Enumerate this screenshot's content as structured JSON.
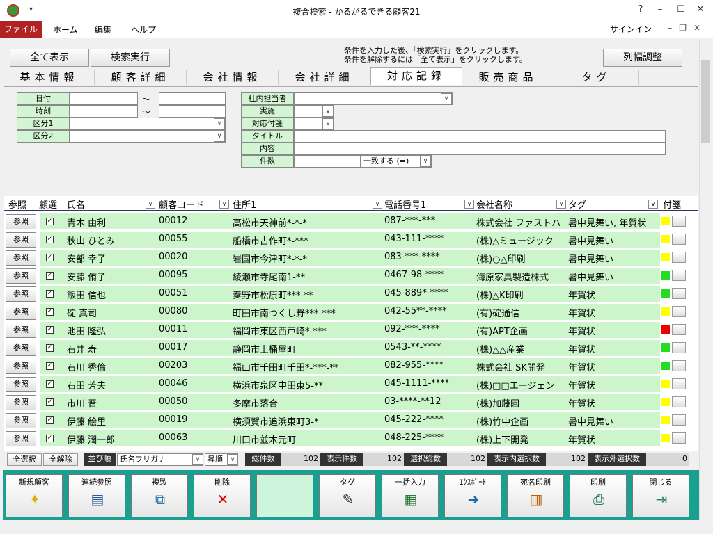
{
  "window": {
    "title": "複合検索 - かるがるできる顧客21",
    "help": "?",
    "minimize": "–",
    "maximize": "☐",
    "close": "✕"
  },
  "ribbon": {
    "tabs": [
      "ファイル",
      "ホーム",
      "編集",
      "ヘルプ"
    ],
    "signin": "サインイン"
  },
  "top": {
    "show_all": "全て表示",
    "search": "検索実行",
    "col_adjust": "列幅調整",
    "hint1": "条件を入力した後、「検索実行」をクリックします。",
    "hint2": "条件を解除するには「全て表示」をクリックします。"
  },
  "tabs": [
    "基本情報",
    "顧客詳細",
    "会社情報",
    "会社詳細",
    "対応記録",
    "販売商品",
    "タグ"
  ],
  "cond": {
    "date": "日付",
    "time": "時刻",
    "kubun1": "区分1",
    "kubun2": "区分2",
    "tilde": "～",
    "staff": "社内担当者",
    "done": "実施",
    "attach": "対応付箋",
    "title": "タイトル",
    "content": "内容",
    "count": "件数",
    "match": "一致する (=)"
  },
  "grid": {
    "headers": [
      "参照",
      "顧選",
      "氏名",
      "顧客コード",
      "住所1",
      "電話番号1",
      "会社名称",
      "タグ",
      "付箋"
    ],
    "ref_label": "参照",
    "check": "✓",
    "rows": [
      [
        "青木 由利",
        "00012",
        "高松市天神前*-*-*",
        "087-***-***",
        "株式会社 ファストハ",
        "暑中見舞い, 年賀状",
        "#ffff00"
      ],
      [
        "秋山 ひとみ",
        "00055",
        "船橋市古作町*-***",
        "043-111-****",
        "(株)△ミュージック",
        "暑中見舞い",
        "#ffff00"
      ],
      [
        "安部 幸子",
        "00020",
        "岩国市今津町*-*-*",
        "083-***-****",
        "(株)○△印刷",
        "暑中見舞い",
        "#ffff00"
      ],
      [
        "安藤 侑子",
        "00095",
        "綾瀬市寺尾南1-**",
        "0467-98-****",
        "海原家具製造株式",
        "暑中見舞い",
        "#22dd22"
      ],
      [
        "飯田 信也",
        "00051",
        "秦野市松原町***-**",
        "045-889*-****",
        "(株)△K印刷",
        "年賀状",
        "#22dd22"
      ],
      [
        "碇 真司",
        "00080",
        "町田市南つくし野***-***",
        "042-55**-****",
        "(有)碇通信",
        "年賀状",
        "#ffff00"
      ],
      [
        "池田 隆弘",
        "00011",
        "福岡市東区西戸崎*-***",
        "092-***-****",
        "(有)APT企画",
        "年賀状",
        "#ee0000"
      ],
      [
        "石井 寿",
        "00017",
        "静岡市上桶屋町",
        "0543-**-****",
        "(株)△△産業",
        "年賀状",
        "#22dd22"
      ],
      [
        "石川 秀倫",
        "00203",
        "福山市千田町千田*-***-**",
        "082-955-****",
        "株式会社 SK開発",
        "年賀状",
        "#22dd22"
      ],
      [
        "石田 芳夫",
        "00046",
        "横浜市泉区中田東5-**",
        "045-1111-****",
        "(株)□□エージェン",
        "年賀状",
        "#ffff00"
      ],
      [
        "市川 晋",
        "00050",
        "多摩市落合",
        "03-****-**12",
        "(株)加藤園",
        "年賀状",
        "#ffff00"
      ],
      [
        "伊藤 絵里",
        "00019",
        "横須賀市追浜東町3-*",
        "045-222-****",
        "(株)竹中企画",
        "暑中見舞い",
        "#ffff00"
      ],
      [
        "伊藤 潤一郎",
        "00063",
        "川口市並木元町",
        "048-225-****",
        "(株)上下開発",
        "年賀状",
        "#ffff00"
      ]
    ]
  },
  "status": {
    "select_all": "全選択",
    "deselect_all": "全解除",
    "sort": "並び順",
    "sort_field": "氏名フリガナ",
    "order": "昇順",
    "total": "総件数",
    "total_v": "102",
    "shown": "表示件数",
    "shown_v": "102",
    "sel_total": "選択総数",
    "sel_total_v": "102",
    "sel_in": "表示内選択数",
    "sel_in_v": "102",
    "sel_out": "表示外選択数",
    "sel_out_v": "0"
  },
  "toolbar": [
    "新規顧客",
    "連続参照",
    "複製",
    "削除",
    "",
    "タグ",
    "一括入力",
    "ｴｸｽﾎﾟｰﾄ",
    "宛名印刷",
    "印刷",
    "閉じる"
  ],
  "icons": {
    "new": "✦",
    "multi": "▤",
    "copy": "⧉",
    "delete": "✕",
    "tag": "✎",
    "bulk": "▦",
    "export": "➜",
    "label": "▥",
    "print": "⎙",
    "close": "⇥"
  }
}
